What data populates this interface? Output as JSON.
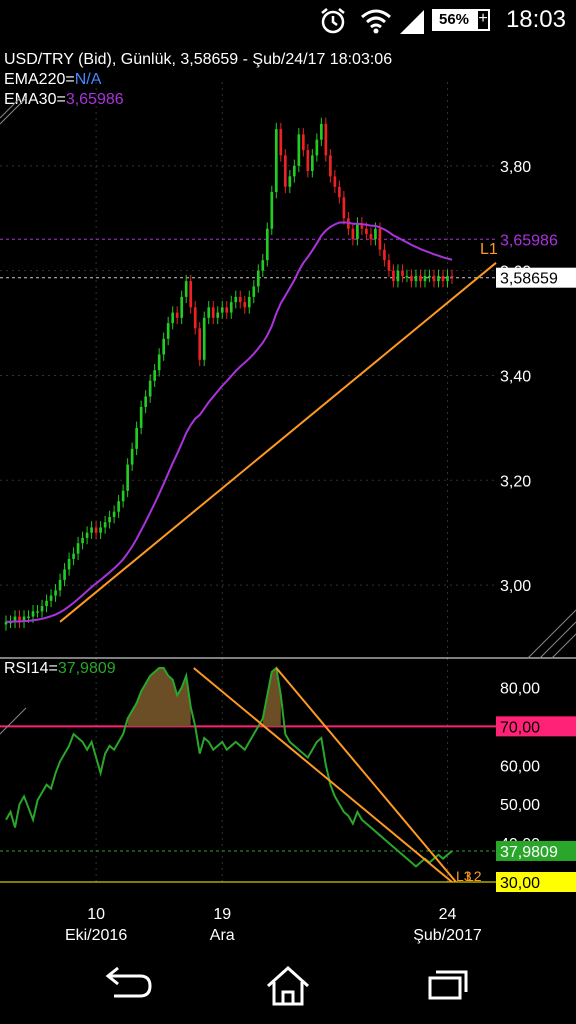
{
  "status_bar": {
    "battery": "56%",
    "time": "18:03",
    "icons": [
      "alarm-icon",
      "wifi-icon",
      "signal-icon",
      "battery-icon"
    ]
  },
  "header": {
    "title": "USD/TRY (Bid),  Günlük, 3,58659 - Şub/24/17 18:03:06",
    "ema220_label": "EMA220=",
    "ema220_value": "N/A",
    "ema30_label": "EMA30=",
    "ema30_value": "3,65986"
  },
  "colors": {
    "bull": "#22cc22",
    "bear": "#ee2222",
    "ema30": "#aa33dd",
    "trendline": "#ff9922",
    "rsi_line": "#2aa62a",
    "rsi_fill": "#6b4d26",
    "level70": "#ff2277",
    "level30": "#ffff00"
  },
  "chart_data": [
    {
      "type": "line",
      "title": "USD/TRY (Bid),  Günlük, 3,58659 - Şub/24/17 18:03:06",
      "ylim": [
        2.88,
        3.96
      ],
      "y_ticks": [
        "3,80",
        "3,60",
        "3,40",
        "3,20",
        "3,00"
      ],
      "x_ticks": [
        "10",
        "19",
        "24"
      ],
      "x_tick_sublabels": [
        "Eki/2016",
        "Ara",
        "Şub/2017"
      ],
      "x_tick_index": [
        20,
        48,
        98
      ],
      "num_bars": 100,
      "price": [
        2.93,
        2.93,
        2.94,
        2.93,
        2.94,
        2.94,
        2.95,
        2.95,
        2.96,
        2.97,
        2.98,
        2.99,
        3.01,
        3.03,
        3.05,
        3.06,
        3.08,
        3.09,
        3.1,
        3.11,
        3.1,
        3.11,
        3.12,
        3.13,
        3.14,
        3.16,
        3.18,
        3.23,
        3.26,
        3.3,
        3.34,
        3.36,
        3.39,
        3.41,
        3.44,
        3.47,
        3.5,
        3.52,
        3.51,
        3.55,
        3.58,
        3.53,
        3.49,
        3.43,
        3.51,
        3.53,
        3.51,
        3.52,
        3.53,
        3.52,
        3.54,
        3.55,
        3.54,
        3.53,
        3.55,
        3.57,
        3.6,
        3.62,
        3.68,
        3.75,
        3.87,
        3.82,
        3.76,
        3.78,
        3.8,
        3.86,
        3.83,
        3.79,
        3.82,
        3.85,
        3.88,
        3.82,
        3.78,
        3.76,
        3.74,
        3.7,
        3.68,
        3.66,
        3.69,
        3.68,
        3.67,
        3.66,
        3.68,
        3.64,
        3.62,
        3.6,
        3.58,
        3.6,
        3.59,
        3.59,
        3.58,
        3.59,
        3.58,
        3.59,
        3.59,
        3.58,
        3.59,
        3.58,
        3.59,
        3.58659
      ],
      "series": [
        {
          "name": "EMA30",
          "last_value": "3,65986"
        }
      ],
      "price_labels": [
        {
          "text": "3,65986",
          "value": 3.65986
        },
        {
          "text": "3,58659",
          "value": 3.58659
        }
      ],
      "trendline_label": "L1"
    },
    {
      "type": "line",
      "title": "RSI14",
      "value_label": "37,9809",
      "ylim": [
        30,
        85
      ],
      "y_ticks": [
        "80,00",
        "70,00",
        "60,00",
        "50,00",
        "40,00",
        "30,00"
      ],
      "levels": [
        {
          "text": "70,00",
          "value": 70
        },
        {
          "text": "30,00",
          "value": 30
        }
      ],
      "current": {
        "text": "37,9809",
        "value": 37.98
      },
      "trendline_labels": [
        "L3",
        "L2"
      ],
      "rsi": [
        46,
        48,
        44,
        50,
        52,
        49,
        46,
        51,
        53,
        55,
        54,
        58,
        61,
        63,
        65,
        68,
        67,
        66,
        64,
        66,
        62,
        58,
        63,
        65,
        64,
        66,
        68,
        72,
        74,
        76,
        79,
        81,
        83,
        84,
        86,
        85,
        83,
        82,
        78,
        80,
        83,
        75,
        70,
        63,
        67,
        66,
        64,
        65,
        66,
        64,
        65,
        66,
        65,
        64,
        66,
        68,
        70,
        72,
        78,
        84,
        88,
        78,
        68,
        66,
        65,
        64,
        63,
        62,
        64,
        66,
        67,
        60,
        55,
        52,
        50,
        48,
        47,
        45,
        48,
        46,
        45,
        44,
        43,
        42,
        41,
        40,
        39,
        38,
        37,
        36,
        35,
        34,
        35,
        36,
        35,
        36,
        37,
        36,
        37,
        37.98
      ]
    }
  ]
}
